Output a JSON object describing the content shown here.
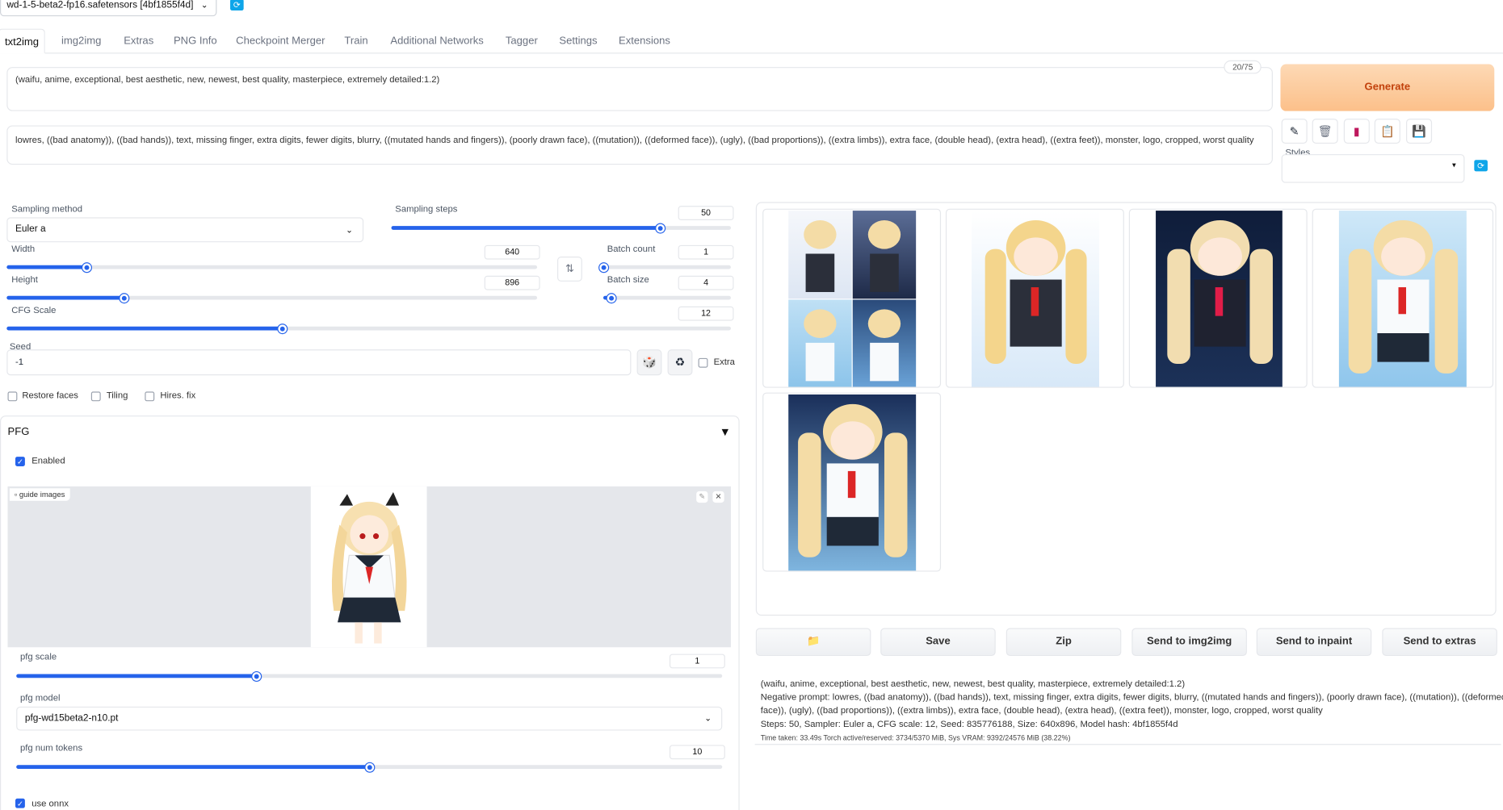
{
  "checkpoint": {
    "label": "wd-1-5-beta2-fp16.safetensors [4bf1855f4d]"
  },
  "tabs": [
    "txt2img",
    "img2img",
    "Extras",
    "PNG Info",
    "Checkpoint Merger",
    "Train",
    "Additional Networks",
    "Tagger",
    "Settings",
    "Extensions"
  ],
  "prompt": {
    "text": "(waifu, anime, exceptional, best aesthetic, new, newest, best quality, masterpiece, extremely detailed:1.2)",
    "token_counter": "20/75"
  },
  "negative_prompt": {
    "text": "lowres, ((bad anatomy)), ((bad hands)), text, missing finger, extra digits, fewer digits, blurry, ((mutated hands and fingers)), (poorly drawn face), ((mutation)), ((deformed face)), (ugly), ((bad proportions)), ((extra limbs)), extra face, (double head), (extra head), ((extra feet)), monster, logo, cropped, worst quality"
  },
  "generate_label": "Generate",
  "styles_label": "Styles",
  "sampling_method": {
    "label": "Sampling method",
    "value": "Euler a"
  },
  "sampling_steps": {
    "label": "Sampling steps",
    "value": "50",
    "fraction": 0.79
  },
  "width": {
    "label": "Width",
    "value": "640",
    "fraction": 0.15
  },
  "height": {
    "label": "Height",
    "value": "896",
    "fraction": 0.22
  },
  "batch_count": {
    "label": "Batch count",
    "value": "1",
    "fraction": 0.0
  },
  "batch_size": {
    "label": "Batch size",
    "value": "4",
    "fraction": 0.06
  },
  "cfg_scale": {
    "label": "CFG Scale",
    "value": "12",
    "fraction": 0.38
  },
  "seed": {
    "label": "Seed",
    "value": "-1",
    "extra_label": "Extra"
  },
  "checkboxes": {
    "restore_faces": "Restore faces",
    "tiling": "Tiling",
    "hires_fix": "Hires. fix"
  },
  "pfg": {
    "title": "PFG",
    "enabled_label": "Enabled",
    "guide_images_label": "guide images",
    "scale": {
      "label": "pfg scale",
      "value": "1",
      "fraction": 0.34
    },
    "model": {
      "label": "pfg model",
      "value": "pfg-wd15beta2-n10.pt"
    },
    "num_tokens": {
      "label": "pfg num tokens",
      "value": "10",
      "fraction": 0.5
    },
    "use_onnx_label": "use onnx"
  },
  "buttons": {
    "save": "Save",
    "zip": "Zip",
    "send_img2img": "Send to img2img",
    "send_inpaint": "Send to inpaint",
    "send_extras": "Send to extras"
  },
  "generation_info": {
    "line1": "(waifu, anime, exceptional, best aesthetic, new, newest, best quality, masterpiece, extremely detailed:1.2)",
    "line2": "Negative prompt: lowres, ((bad anatomy)), ((bad hands)), text, missing finger, extra digits, fewer digits, blurry, ((mutated hands and fingers)), (poorly drawn face), ((mutation)), ((deformed",
    "line3": "face)), (ugly), ((bad proportions)), ((extra limbs)), extra face, (double head), (extra head), ((extra feet)), monster, logo, cropped, worst quality",
    "line4": "Steps: 50, Sampler: Euler a, CFG scale: 12, Seed: 835776188, Size: 640x896, Model hash: 4bf1855f4d",
    "line5": "Time taken: 33.49s  Torch active/reserved: 3734/5370 MiB, Sys VRAM: 9392/24576 MiB (38.22%)"
  },
  "colors": {
    "accent": "#2563eb",
    "generate_bg": "#fcc08a",
    "generate_text": "#c2410c"
  }
}
